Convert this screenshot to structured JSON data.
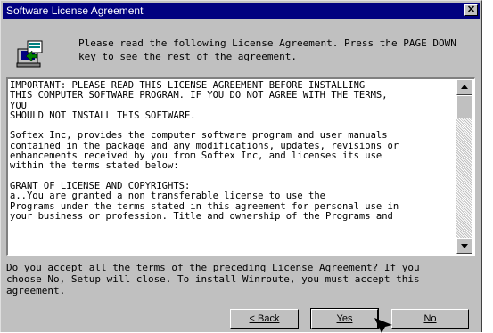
{
  "window": {
    "title": "Software License Agreement",
    "close_glyph": "✕"
  },
  "header": {
    "icon": "computer-install-icon",
    "instruction": "Please read the following License Agreement.  Press the PAGE DOWN\nkey to see the rest of the agreement."
  },
  "license_text": "IMPORTANT:  PLEASE READ THIS LICENSE AGREEMENT BEFORE INSTALLING\nTHIS COMPUTER SOFTWARE PROGRAM. IF YOU DO NOT AGREE WITH THE TERMS,\nYOU\nSHOULD NOT INSTALL THIS SOFTWARE.\n\nSoftex Inc, provides the computer software program and user manuals\ncontained in the package and any modifications, updates, revisions or\nenhancements received by you from Softex Inc, and licenses its use\nwithin the terms stated below:\n\nGRANT OF LICENSE AND COPYRIGHTS:\na..You are granted a non transferable license to use the\nPrograms under the terms stated in this agreement for personal use in\nyour business or profession.  Title and ownership of the Programs and",
  "question": "Do you accept all the terms of the preceding License Agreement?  If you\nchoose No,  Setup will close.  To install Winroute, you must accept this\nagreement.",
  "buttons": {
    "back": "< Back",
    "yes": "Yes",
    "no": "No"
  },
  "colors": {
    "title_bar": "#000080",
    "dialog": "#c0c0c0"
  }
}
